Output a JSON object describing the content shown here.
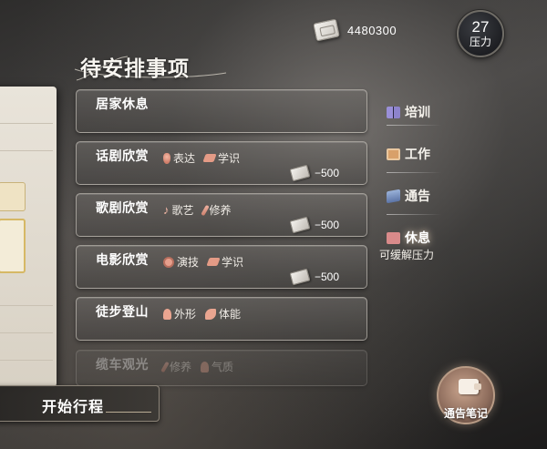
{
  "currency": {
    "icon": "cash-icon",
    "value": "4480300"
  },
  "stress": {
    "value": "27",
    "label": "压力"
  },
  "title": "待安排事项",
  "schedule_items": [
    {
      "name": "居家休息",
      "attrs": [],
      "cost": ""
    },
    {
      "name": "话剧欣赏",
      "attrs": [
        {
          "icon": "mic-icon",
          "label": "表达"
        },
        {
          "icon": "graduation-cap-icon",
          "label": "学识"
        }
      ],
      "cost": "−500"
    },
    {
      "name": "歌剧欣赏",
      "attrs": [
        {
          "icon": "music-note-icon",
          "label": "歌艺"
        },
        {
          "icon": "brush-icon",
          "label": "修养"
        }
      ],
      "cost": "−500"
    },
    {
      "name": "电影欣赏",
      "attrs": [
        {
          "icon": "film-reel-icon",
          "label": "演技"
        },
        {
          "icon": "graduation-cap-icon",
          "label": "学识"
        }
      ],
      "cost": "−500"
    },
    {
      "name": "徒步登山",
      "attrs": [
        {
          "icon": "body-icon",
          "label": "外形"
        },
        {
          "icon": "muscle-arm-icon",
          "label": "体能"
        }
      ],
      "cost": ""
    },
    {
      "name": "缆车观光",
      "attrs": [
        {
          "icon": "brush-icon",
          "label": "修养"
        },
        {
          "icon": "body-icon",
          "label": "气质"
        }
      ],
      "cost": ""
    }
  ],
  "categories": [
    {
      "icon": "book-icon",
      "label": "培训"
    },
    {
      "icon": "briefcase-icon",
      "label": "工作"
    },
    {
      "icon": "announcement-icon",
      "label": "通告"
    },
    {
      "icon": "rest-icon",
      "label": "休息",
      "subtitle": "可缓解压力"
    }
  ],
  "start_button": {
    "label": "开始行程"
  },
  "notes_button": {
    "icon": "wallet-icon",
    "label": "通告笔记"
  },
  "colors": {
    "accent_attr": "#e49b86",
    "panel_border": "#e1dcd4"
  }
}
